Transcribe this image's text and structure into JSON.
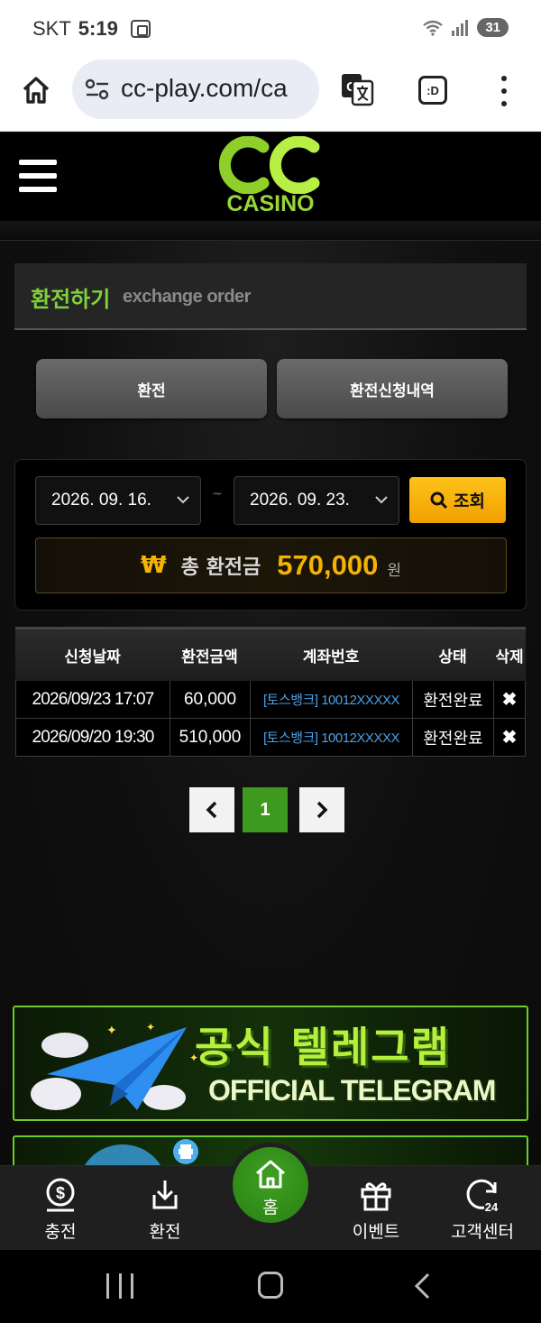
{
  "status_bar": {
    "carrier": "SKT",
    "time": "5:19",
    "battery": "31"
  },
  "browser": {
    "url": "cc-play.com/ca",
    "tabs_label": ":D"
  },
  "site": {
    "logo_text": "CASINO"
  },
  "section": {
    "title_ko": "환전하기",
    "title_en": "exchange order"
  },
  "tabs": {
    "exchange": "환전",
    "history": "환전신청내역"
  },
  "search": {
    "date_from": "2026. 09. 16.",
    "date_to": "2026. 09. 23.",
    "separator": "~",
    "button": "조회"
  },
  "total": {
    "currency_symbol": "₩",
    "label": "총 환전금",
    "amount": "570,000",
    "unit": "원"
  },
  "table": {
    "headers": [
      "신청날짜",
      "환전금액",
      "계좌번호",
      "상태",
      "삭제"
    ],
    "rows": [
      {
        "date": "2026/09/23 17:07",
        "amount": "60,000",
        "account": "[토스뱅크] 10012XXXXX",
        "status": "환전완료",
        "delete": "✖"
      },
      {
        "date": "2026/09/20 19:30",
        "amount": "510,000",
        "account": "[토스뱅크] 10012XXXXX",
        "status": "환전완료",
        "delete": "✖"
      }
    ]
  },
  "pagination": {
    "current": "1"
  },
  "banners": {
    "telegram_ko": "공식 텔레그램",
    "telegram_en": "OFFICIAL TELEGRAM"
  },
  "bottom_nav": {
    "charge": "충전",
    "exchange": "환전",
    "home": "홈",
    "event": "이벤트",
    "support": "고객센터"
  },
  "colors": {
    "accent_green": "#7fd23a",
    "gold": "#f5b300",
    "link_blue": "#4aa0e6",
    "active_page": "#3e9a1e"
  }
}
